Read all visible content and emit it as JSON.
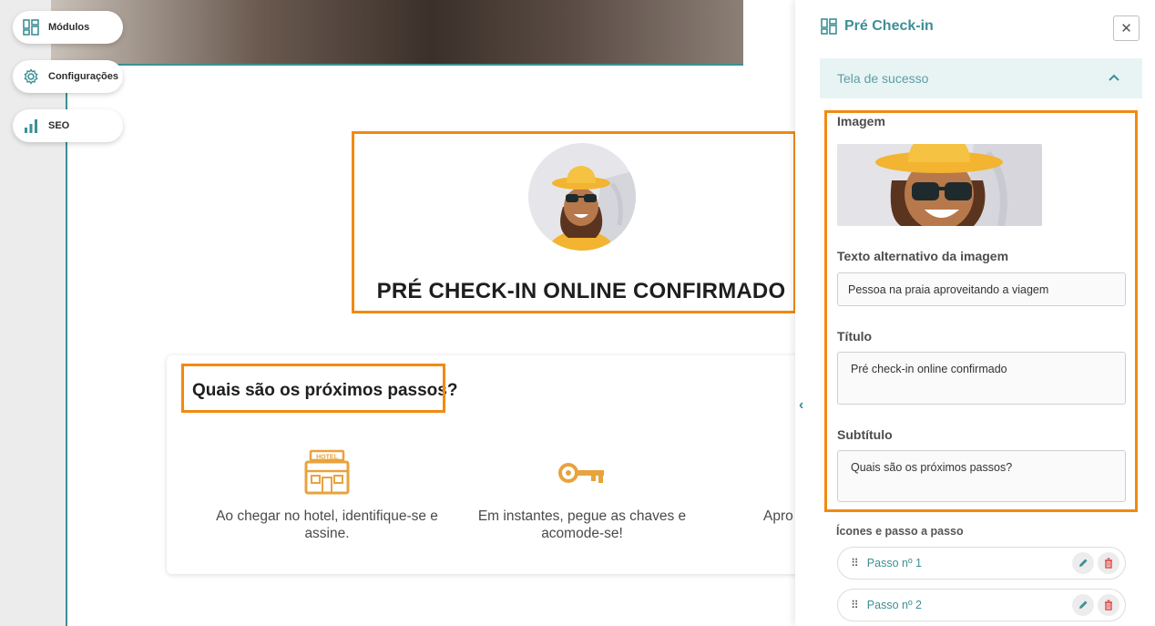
{
  "nav": {
    "modules_label": "Módulos",
    "settings_label": "Configurações",
    "seo_label": "SEO"
  },
  "preview": {
    "success_title": "PRÉ CHECK-IN ONLINE CONFIRMADO",
    "steps_title": "Quais são os próximos passos?",
    "steps": [
      {
        "icon": "hotel-icon",
        "text": "Ao chegar no hotel, identifique-se e assine."
      },
      {
        "icon": "key-icon",
        "text": "Em instantes, pegue as chaves e acomode-se!"
      },
      {
        "icon": "",
        "text": "Apro"
      }
    ],
    "hotel_sign": "HOTEL"
  },
  "panel": {
    "title": "Pré Check-in",
    "section_label": "Tela de sucesso",
    "image_label": "Imagem",
    "alt_text_label": "Texto alternativo da imagem",
    "alt_text_value": "Pessoa na praia aproveitando a viagem",
    "title_label": "Título",
    "title_value": "Pré check-in online confirmado",
    "subtitle_label": "Subtítulo",
    "subtitle_value": "Quais são os próximos passos?",
    "icons_label": "Ícones e passo a passo",
    "step_items": [
      {
        "label": "Passo nº 1"
      },
      {
        "label": "Passo nº 2"
      }
    ]
  },
  "colors": {
    "accent": "#3d8f96",
    "highlight": "#f28a12",
    "icon_orange": "#e8a33d",
    "delete_red": "#e04848"
  }
}
